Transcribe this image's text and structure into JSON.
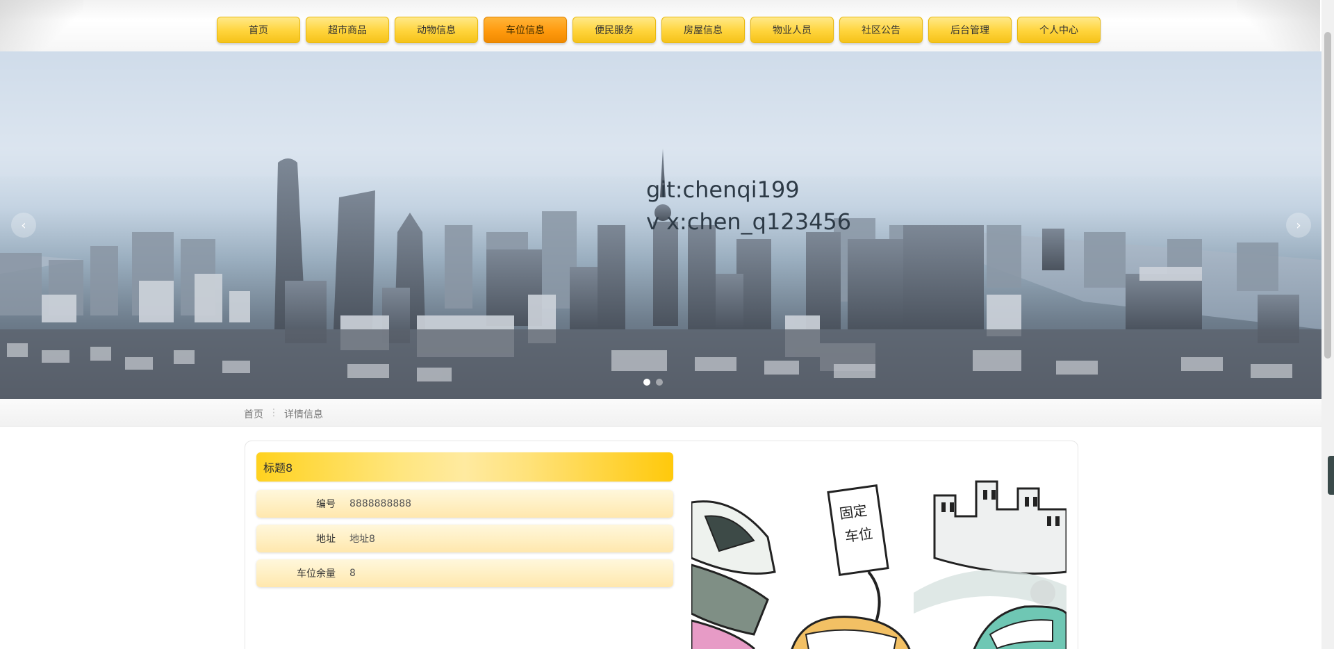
{
  "nav": {
    "items": [
      {
        "label": "首页",
        "active": false
      },
      {
        "label": "超市商品",
        "active": false
      },
      {
        "label": "动物信息",
        "active": false
      },
      {
        "label": "车位信息",
        "active": true
      },
      {
        "label": "便民服务",
        "active": false
      },
      {
        "label": "房屋信息",
        "active": false
      },
      {
        "label": "物业人员",
        "active": false
      },
      {
        "label": "社区公告",
        "active": false
      },
      {
        "label": "后台管理",
        "active": false
      },
      {
        "label": "个人中心",
        "active": false
      }
    ]
  },
  "banner": {
    "line1": "git:chenqi199",
    "line2": "v x:chen_q123456",
    "prev_icon": "‹",
    "next_icon": "›"
  },
  "breadcrumb": {
    "home": "首页",
    "separator": "⋮",
    "current": "详情信息"
  },
  "detail": {
    "title": "标题8",
    "fields": [
      {
        "label": "编号",
        "value": "8888888888"
      },
      {
        "label": "地址",
        "value": "地址8"
      },
      {
        "label": "车位余量",
        "value": "8"
      }
    ],
    "sign_text": "固定车位"
  },
  "colors": {
    "nav_yellow": "#ffd43b",
    "nav_active": "#ff9a0e",
    "field_bg": "#ffefc2"
  }
}
